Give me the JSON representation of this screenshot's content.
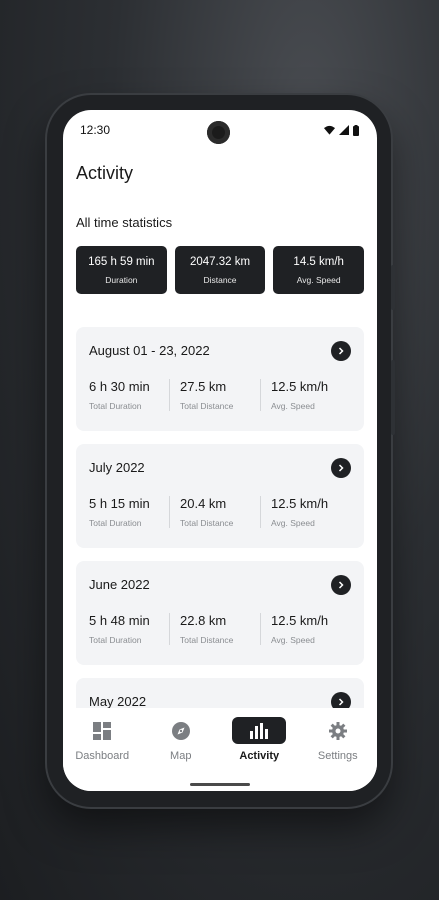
{
  "status_bar": {
    "time": "12:30"
  },
  "header": {
    "title": "Activity"
  },
  "all_time": {
    "label": "All time statistics",
    "stats": [
      {
        "value": "165 h 59 min",
        "label": "Duration"
      },
      {
        "value": "2047.32 km",
        "label": "Distance"
      },
      {
        "value": "14.5 km/h",
        "label": "Avg. Speed"
      }
    ]
  },
  "periods": [
    {
      "title": "August 01 - 23, 2022",
      "metrics": [
        {
          "value": "6 h 30 min",
          "label": "Total Duration"
        },
        {
          "value": "27.5 km",
          "label": "Total Distance"
        },
        {
          "value": "12.5 km/h",
          "label": "Avg. Speed"
        }
      ]
    },
    {
      "title": "July 2022",
      "metrics": [
        {
          "value": "5 h 15 min",
          "label": "Total Duration"
        },
        {
          "value": "20.4 km",
          "label": "Total Distance"
        },
        {
          "value": "12.5 km/h",
          "label": "Avg. Speed"
        }
      ]
    },
    {
      "title": "June 2022",
      "metrics": [
        {
          "value": "5 h 48 min",
          "label": "Total Duration"
        },
        {
          "value": "22.8 km",
          "label": "Total Distance"
        },
        {
          "value": "12.5 km/h",
          "label": "Avg. Speed"
        }
      ]
    },
    {
      "title": "May 2022"
    }
  ],
  "nav": {
    "items": [
      {
        "label": "Dashboard",
        "icon": "dashboard-icon"
      },
      {
        "label": "Map",
        "icon": "compass-icon"
      },
      {
        "label": "Activity",
        "icon": "bar-chart-icon",
        "active": true
      },
      {
        "label": "Settings",
        "icon": "gear-icon"
      }
    ]
  },
  "colors": {
    "accent": "#1f2124",
    "card_bg": "#f3f4f6",
    "muted": "#8a8d91"
  }
}
